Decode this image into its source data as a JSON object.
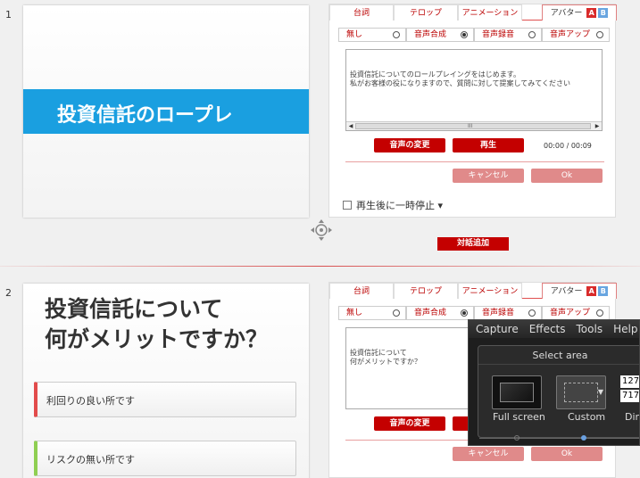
{
  "slides": [
    {
      "number": "1",
      "title": "投資信託のロープレ",
      "tabs": [
        "台詞",
        "テロップ",
        "アニメーション",
        "アバター"
      ],
      "avatar_badges": [
        "A",
        "B"
      ],
      "subtabs": [
        "無し",
        "音声合成",
        "音声録音",
        "音声アップ"
      ],
      "text": "投資信託についてのロールプレイングをはじめます。\n私がお客様の役になりますので、質問に対して提案してみてください",
      "buttons": {
        "change_voice": "音声の変更",
        "play": "再生",
        "cancel": "キャンセル",
        "ok": "Ok"
      },
      "time": "00:00 / 00:09"
    },
    {
      "number": "2",
      "title_line1": "投資信託について",
      "title_line2": "何がメリットですか？",
      "options": [
        "利回りの良い所です",
        "リスクの無い所です"
      ],
      "tabs": [
        "台詞",
        "テロップ",
        "アニメーション",
        "アバター"
      ],
      "avatar_badges": [
        "A",
        "B"
      ],
      "subtabs": [
        "無し",
        "音声合成",
        "音声録音",
        "音声アップ"
      ],
      "text": "投資信託について\n何がメリットですか？",
      "buttons": {
        "change_voice": "音声の変更",
        "cancel": "キャンセル",
        "ok": "Ok"
      }
    }
  ],
  "pause_after_play": "再生後に一時停止 ▾",
  "add_dialogue": "対話追加",
  "scrollbar_grip": "III",
  "capture_tool": {
    "menu": [
      "Capture",
      "Effects",
      "Tools",
      "Help"
    ],
    "section_title": "Select area",
    "full_screen": "Full screen",
    "custom": "Custom",
    "dim_label": "Dim",
    "width": "127",
    "height": "717"
  },
  "colors": {
    "accent_red": "#c40000",
    "band_blue": "#1a9fe0"
  }
}
